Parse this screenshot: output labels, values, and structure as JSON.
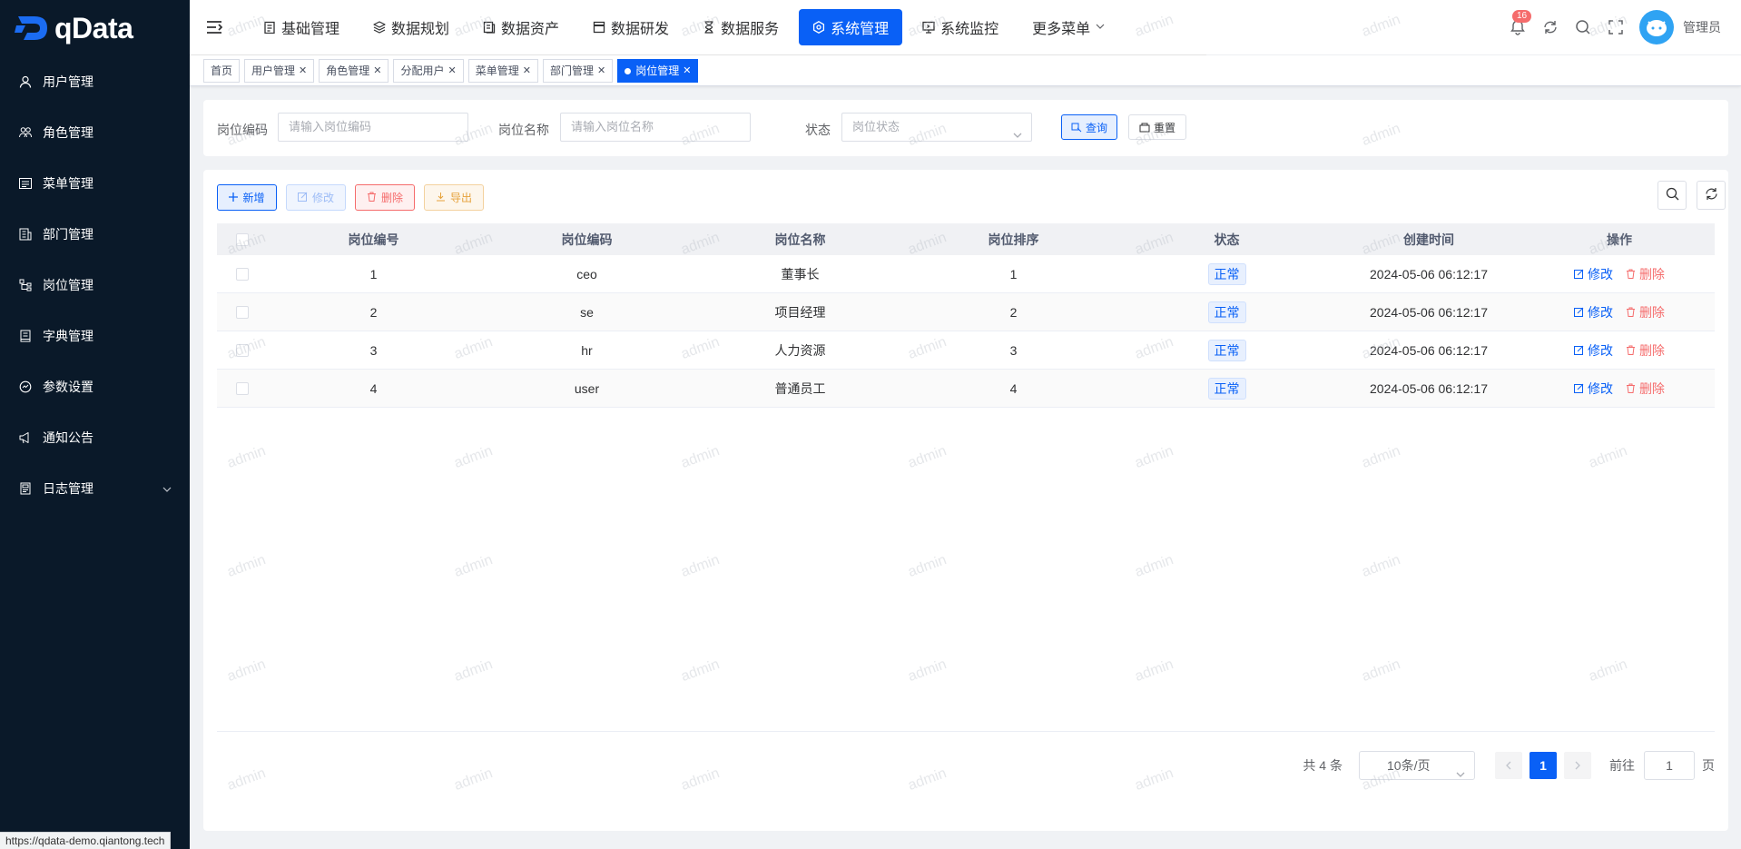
{
  "app": {
    "logo_text": "qData"
  },
  "sidebar": {
    "items": [
      {
        "label": "用户管理",
        "icon": "user-icon"
      },
      {
        "label": "角色管理",
        "icon": "users-icon"
      },
      {
        "label": "菜单管理",
        "icon": "menu-list-icon"
      },
      {
        "label": "部门管理",
        "icon": "department-icon"
      },
      {
        "label": "岗位管理",
        "icon": "post-icon"
      },
      {
        "label": "字典管理",
        "icon": "dictionary-icon"
      },
      {
        "label": "参数设置",
        "icon": "settings-icon"
      },
      {
        "label": "通知公告",
        "icon": "megaphone-icon"
      },
      {
        "label": "日志管理",
        "icon": "log-icon",
        "has_submenu": true
      }
    ]
  },
  "topnav": {
    "items": [
      {
        "label": "基础管理",
        "icon": "clipboard-icon"
      },
      {
        "label": "数据规划",
        "icon": "layers-icon"
      },
      {
        "label": "数据资产",
        "icon": "asset-icon"
      },
      {
        "label": "数据研发",
        "icon": "window-icon"
      },
      {
        "label": "数据服务",
        "icon": "hourglass-icon"
      },
      {
        "label": "系统管理",
        "icon": "gear-icon",
        "active": true
      },
      {
        "label": "系统监控",
        "icon": "monitor-icon"
      },
      {
        "label": "更多菜单",
        "icon": "",
        "has_dropdown": true
      }
    ],
    "notification_count": "16",
    "username": "管理员"
  },
  "tags": [
    {
      "label": "首页",
      "closable": false
    },
    {
      "label": "用户管理",
      "closable": true
    },
    {
      "label": "角色管理",
      "closable": true
    },
    {
      "label": "分配用户",
      "closable": true
    },
    {
      "label": "菜单管理",
      "closable": true
    },
    {
      "label": "部门管理",
      "closable": true
    },
    {
      "label": "岗位管理",
      "closable": true,
      "active": true
    }
  ],
  "search": {
    "post_code_label": "岗位编码",
    "post_code_placeholder": "请输入岗位编码",
    "post_name_label": "岗位名称",
    "post_name_placeholder": "请输入岗位名称",
    "status_label": "状态",
    "status_placeholder": "岗位状态",
    "query_label": "查询",
    "reset_label": "重置"
  },
  "toolbar": {
    "add_label": "新增",
    "edit_label": "修改",
    "delete_label": "删除",
    "export_label": "导出"
  },
  "table": {
    "columns": [
      "岗位编号",
      "岗位编码",
      "岗位名称",
      "岗位排序",
      "状态",
      "创建时间",
      "操作"
    ],
    "rows": [
      {
        "id": "1",
        "code": "ceo",
        "name": "董事长",
        "sort": "1",
        "status": "正常",
        "created": "2024-05-06 06:12:17"
      },
      {
        "id": "2",
        "code": "se",
        "name": "项目经理",
        "sort": "2",
        "status": "正常",
        "created": "2024-05-06 06:12:17"
      },
      {
        "id": "3",
        "code": "hr",
        "name": "人力资源",
        "sort": "3",
        "status": "正常",
        "created": "2024-05-06 06:12:17"
      },
      {
        "id": "4",
        "code": "user",
        "name": "普通员工",
        "sort": "4",
        "status": "正常",
        "created": "2024-05-06 06:12:17"
      }
    ],
    "row_edit_label": "修改",
    "row_delete_label": "删除"
  },
  "pagination": {
    "total_text": "共 4 条",
    "page_size": "10条/页",
    "current_page": "1",
    "goto_label": "前往",
    "goto_value": "1",
    "page_suffix": "页"
  },
  "watermark_text": "admin",
  "status_url": "https://qdata-demo.qiantong.tech",
  "colors": {
    "primary": "#0960f6",
    "sidebar_bg": "#0a1929",
    "danger": "#f56c6c",
    "warning": "#e6a23c"
  }
}
